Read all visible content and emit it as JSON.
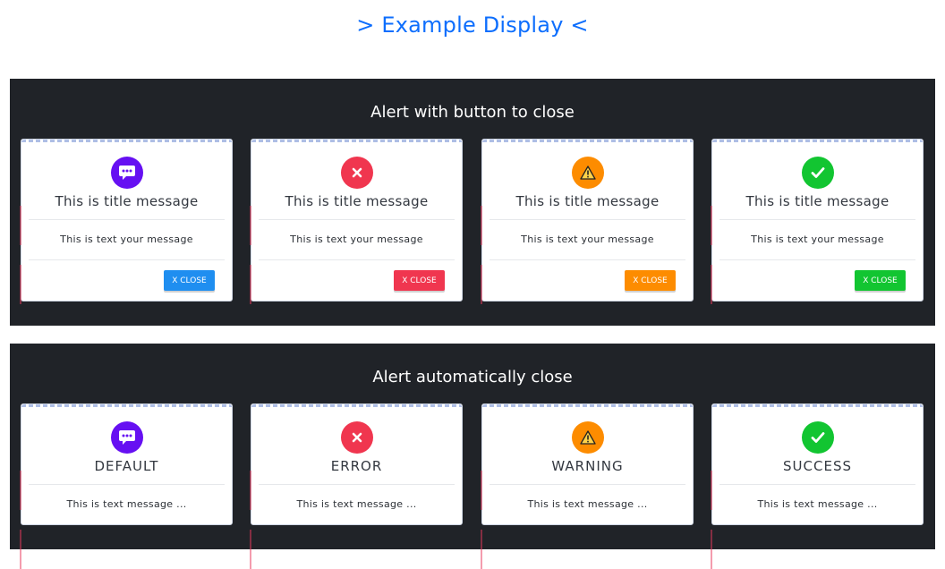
{
  "page": {
    "title": "> Example Display <"
  },
  "section_button": {
    "heading": "Alert with button to close",
    "cards": [
      {
        "title": "This is title message",
        "text": "This is text your message",
        "button": "X CLOSE",
        "icon": "speech-bubble-icon",
        "color": "#6610f2",
        "button_color": "#1f8ef0"
      },
      {
        "title": "This is title message",
        "text": "This is text your message",
        "button": "X CLOSE",
        "icon": "x-icon",
        "color": "#f0364f",
        "button_color": "#f0364f"
      },
      {
        "title": "This is title message",
        "text": "This is text your message",
        "button": "X CLOSE",
        "icon": "warning-icon",
        "color": "#fd8c00",
        "button_color": "#fd8c00"
      },
      {
        "title": "This is title message",
        "text": "This is text your message",
        "button": "X CLOSE",
        "icon": "checkmark-icon",
        "color": "#12c531",
        "button_color": "#12c531"
      }
    ]
  },
  "section_auto": {
    "heading": "Alert automatically close",
    "cards": [
      {
        "title": "DEFAULT",
        "text": "This is text message ...",
        "icon": "speech-bubble-icon",
        "color": "#6610f2"
      },
      {
        "title": "ERROR",
        "text": "This is text message ...",
        "icon": "x-icon",
        "color": "#f0364f"
      },
      {
        "title": "WARNING",
        "text": "This is text message ...",
        "icon": "warning-icon",
        "color": "#fd8c00"
      },
      {
        "title": "SUCCESS",
        "text": "This is text message ...",
        "icon": "checkmark-icon",
        "color": "#12c531"
      }
    ]
  },
  "colors": {
    "accent": "#0d6efd",
    "panel_background": "#202328"
  }
}
